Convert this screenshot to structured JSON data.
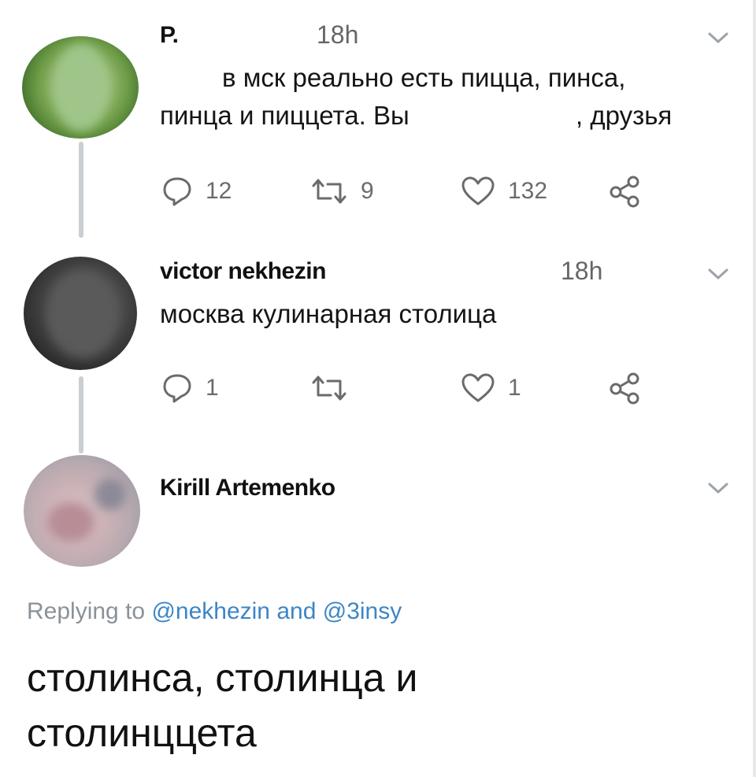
{
  "tweets": [
    {
      "author": "P.",
      "time": "18h",
      "text_line1": "в мск реально есть пицца, пинса,",
      "text_line2_a": "пинца и пиццета. Вы",
      "text_line2_b": ", друзья",
      "replies": "12",
      "retweets": "9",
      "likes": "132"
    },
    {
      "author": "victor nekhezin",
      "time": "18h",
      "text": "москва кулинарная столица",
      "replies": "1",
      "retweets": "",
      "likes": "1"
    },
    {
      "author": "Kirill Artemenko"
    }
  ],
  "reply_context": {
    "prefix": "Replying to",
    "handle1": "@nekhezin",
    "and": "and",
    "handle2": "@3insy"
  },
  "reply_text_line1": "столинса, столинца и",
  "reply_text_line2": "столинццета",
  "icons": {
    "reply": "reply-icon",
    "retweet": "retweet-icon",
    "like": "heart-icon",
    "share": "share-icon",
    "menu": "chevron-down-icon"
  },
  "colors": {
    "text": "#151515",
    "muted": "#6b6b6b",
    "link": "#3d86c6",
    "thread_line": "#c9ced3"
  }
}
